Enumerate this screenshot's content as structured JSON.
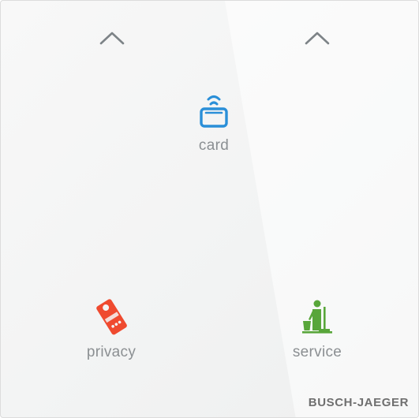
{
  "panel": {
    "background": "#f4f4f4",
    "brand": "BUSCH-JAEGER"
  },
  "arrows": [
    {
      "name": "up-arrow-left",
      "icon": "chevron-up-icon"
    },
    {
      "name": "up-arrow-right",
      "icon": "chevron-up-icon"
    }
  ],
  "controls": {
    "card": {
      "label": "card",
      "icon": "card-reader-icon",
      "color": "#2a8fd8"
    },
    "privacy": {
      "label": "privacy",
      "icon": "do-not-disturb-hanger-icon",
      "color": "#ef4a2f"
    },
    "service": {
      "label": "service",
      "icon": "housekeeping-service-icon",
      "color": "#58a63a"
    }
  },
  "colors": {
    "arrow": "#7d8387",
    "label": "#8b8f92",
    "brand": "#6f6f6f"
  }
}
